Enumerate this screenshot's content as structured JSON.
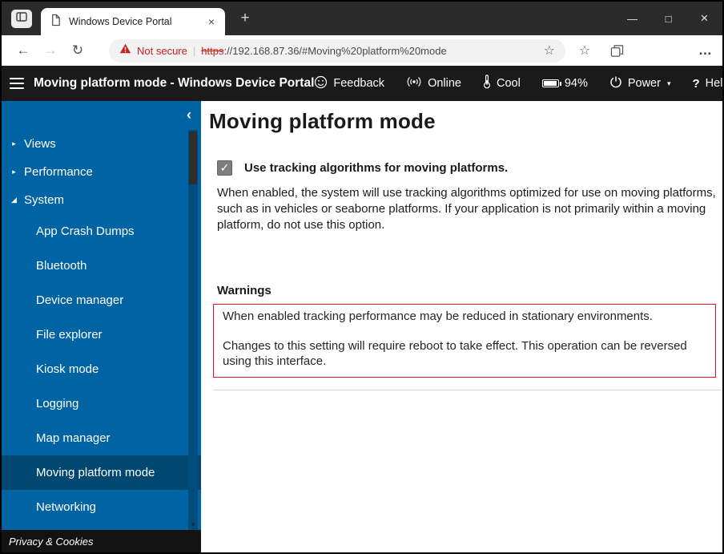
{
  "browser": {
    "tab_title": "Windows Device Portal",
    "not_secure": "Not secure",
    "url_scheme": "https",
    "url_rest": "://192.168.87.36/#Moving%20platform%20mode"
  },
  "header": {
    "title": "Moving platform mode - Windows Device Portal",
    "feedback": "Feedback",
    "online": "Online",
    "thermal": "Cool",
    "battery": "94%",
    "power": "Power",
    "help": "Help"
  },
  "sidebar": {
    "sections": [
      {
        "label": "Views"
      },
      {
        "label": "Performance"
      },
      {
        "label": "System"
      }
    ],
    "system_items": [
      "App Crash Dumps",
      "Bluetooth",
      "Device manager",
      "File explorer",
      "Kiosk mode",
      "Logging",
      "Map manager",
      "Moving platform mode",
      "Networking"
    ],
    "selected_item": "Moving platform mode",
    "footer": "Privacy & Cookies"
  },
  "main": {
    "title": "Moving platform mode",
    "checkbox_checked": "✓",
    "checkbox_label": "Use tracking algorithms for moving platforms.",
    "description": "When enabled, the system will use tracking algorithms optimized for use on moving platforms, such as in vehicles or seaborne platforms. If your application is not primarily within a moving platform, do not use this option.",
    "warnings_title": "Warnings",
    "warnings": [
      "When enabled tracking performance may be reduced in stationary environments.",
      "Changes to this setting will require reboot to take effect. This operation can be reversed using this interface."
    ]
  },
  "icons": {
    "back": "←",
    "forward": "→",
    "refresh": "↻",
    "new_tab": "+",
    "tab_close": "×",
    "minimize": "—",
    "maximize": "□",
    "close": "×",
    "ellipsis": "…",
    "favorites_star": "☆",
    "collapse": "‹",
    "collapsed_marker": "▸",
    "expanded_marker": "◢",
    "caret_down": "▾",
    "help": "?",
    "scroll_down": "▾",
    "separator": "|"
  },
  "colors": {
    "sidebar_blue": "#0063a3",
    "sidebar_selected": "#004872",
    "warning_red": "#e81123",
    "not_secure_red": "#c5221f",
    "header_black": "#1a1a1a"
  }
}
